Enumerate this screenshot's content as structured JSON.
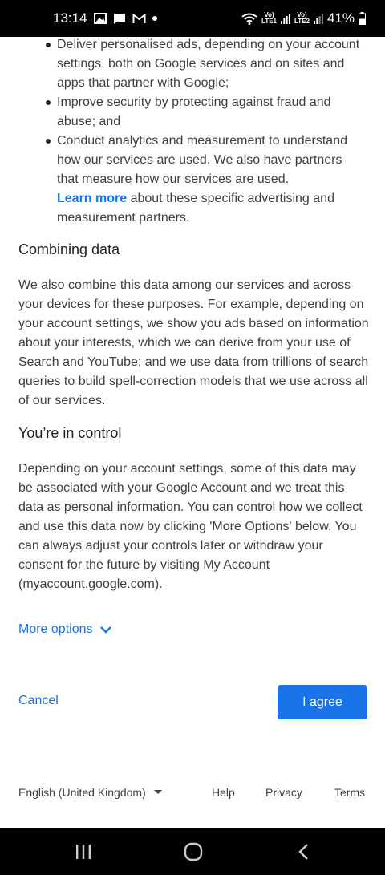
{
  "status_bar": {
    "time": "13:14",
    "battery": "41%",
    "sim1_top": "Vo)",
    "sim1_bottom": "LTE1",
    "sim2_top": "Vo)",
    "sim2_bottom": "LTE2"
  },
  "intro_list": [
    "Deliver personalised ads, depending on your account settings, both on Google services and on sites and apps that partner with Google;",
    "Improve security by protecting against fraud and abuse; and",
    "Conduct analytics and measurement to understand how our services are used. We also have partners that measure how our services are used."
  ],
  "learn_more": {
    "link": "Learn more",
    "text": " about these specific advertising and measurement partners."
  },
  "combining": {
    "heading": "Combining data",
    "body": "We also combine this data among our services and across your devices for these purposes. For example, depending on your account settings, we show you ads based on information about your interests, which we can derive from your use of Search and YouTube; and we use data from trillions of search queries to build spell-correction models that we use across all of our services."
  },
  "control": {
    "heading": "You’re in control",
    "body": "Depending on your account settings, some of this data may be associated with your Google Account and we treat this data as personal information. You can control how we collect and use this data now by clicking 'More Options' below. You can always adjust your controls later or withdraw your consent for the future by visiting My Account (myaccount.google.com)."
  },
  "more_options": "More options",
  "actions": {
    "cancel": "Cancel",
    "agree": "I agree"
  },
  "footer": {
    "language": "English (United Kingdom)",
    "help": "Help",
    "privacy": "Privacy",
    "terms": "Terms"
  },
  "colors": {
    "accent": "#1a73e8",
    "text": "#3c4043",
    "heading": "#202124"
  }
}
